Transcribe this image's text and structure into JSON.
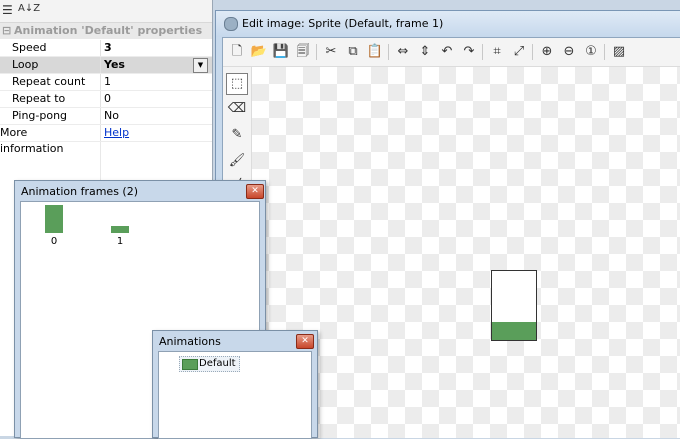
{
  "properties": {
    "toolbar_icon_1": "☰",
    "toolbar_icon_2": "A↓Z",
    "section_title": "Animation 'Default' properties",
    "collapse_glyph": "⊟",
    "rows": [
      {
        "name": "Speed",
        "value": "3"
      },
      {
        "name": "Loop",
        "value": "Yes"
      },
      {
        "name": "Repeat count",
        "value": "1"
      },
      {
        "name": "Repeat to",
        "value": "0"
      },
      {
        "name": "Ping-pong",
        "value": "No"
      },
      {
        "name": "More information",
        "value": "Help"
      }
    ],
    "dropdown_arrow": "▼"
  },
  "edit_window": {
    "title": "Edit image: Sprite (Default, frame 1)",
    "toolbar_icons": [
      "new-icon",
      "open-icon",
      "save-icon",
      "save-all-icon",
      "cut-icon",
      "copy-icon",
      "paste-icon",
      "flip-horizontal-icon",
      "flip-vertical-icon",
      "rotate-ccw-icon",
      "rotate-cw-icon",
      "crop-icon",
      "resize-icon",
      "zoom-in-icon",
      "zoom-out-icon",
      "zoom-reset-icon",
      "grid-icon"
    ],
    "toolbar_glyphs": [
      "🗋",
      "📂",
      "💾",
      "🗐",
      "✂",
      "⧉",
      "📋",
      "⇔",
      "⇕",
      "↶",
      "↷",
      "⌗",
      "⤢",
      "⊕",
      "⊖",
      "①",
      "▨"
    ],
    "tool_icons": [
      "selection-tool-icon",
      "eraser-tool-icon",
      "pencil-tool-icon",
      "brush-tool-icon",
      "line-tool-icon"
    ],
    "tool_glyphs": [
      "⬚",
      "⌫",
      "✎",
      "🖌",
      "╱"
    ],
    "sprite_fill_fraction": 0.26,
    "sprite_color": "#5a9e5a"
  },
  "frames_window": {
    "title": "Animation frames (2)",
    "close_glyph": "✕",
    "frames": [
      {
        "label": "0",
        "fill_fraction": 1.0
      },
      {
        "label": "1",
        "fill_fraction": 0.26
      }
    ]
  },
  "animations_window": {
    "title": "Animations",
    "close_glyph": "✕",
    "items": [
      {
        "label": "Default"
      }
    ]
  }
}
